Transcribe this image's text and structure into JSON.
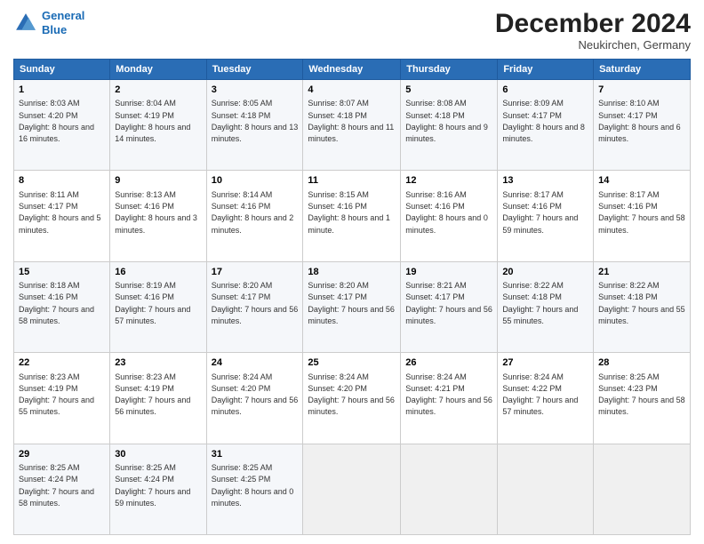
{
  "header": {
    "logo_line1": "General",
    "logo_line2": "Blue",
    "month": "December 2024",
    "location": "Neukirchen, Germany"
  },
  "weekdays": [
    "Sunday",
    "Monday",
    "Tuesday",
    "Wednesday",
    "Thursday",
    "Friday",
    "Saturday"
  ],
  "weeks": [
    [
      {
        "day": "1",
        "sunrise": "8:03 AM",
        "sunset": "4:20 PM",
        "daylight": "8 hours and 16 minutes."
      },
      {
        "day": "2",
        "sunrise": "8:04 AM",
        "sunset": "4:19 PM",
        "daylight": "8 hours and 14 minutes."
      },
      {
        "day": "3",
        "sunrise": "8:05 AM",
        "sunset": "4:18 PM",
        "daylight": "8 hours and 13 minutes."
      },
      {
        "day": "4",
        "sunrise": "8:07 AM",
        "sunset": "4:18 PM",
        "daylight": "8 hours and 11 minutes."
      },
      {
        "day": "5",
        "sunrise": "8:08 AM",
        "sunset": "4:18 PM",
        "daylight": "8 hours and 9 minutes."
      },
      {
        "day": "6",
        "sunrise": "8:09 AM",
        "sunset": "4:17 PM",
        "daylight": "8 hours and 8 minutes."
      },
      {
        "day": "7",
        "sunrise": "8:10 AM",
        "sunset": "4:17 PM",
        "daylight": "8 hours and 6 minutes."
      }
    ],
    [
      {
        "day": "8",
        "sunrise": "8:11 AM",
        "sunset": "4:17 PM",
        "daylight": "8 hours and 5 minutes."
      },
      {
        "day": "9",
        "sunrise": "8:13 AM",
        "sunset": "4:16 PM",
        "daylight": "8 hours and 3 minutes."
      },
      {
        "day": "10",
        "sunrise": "8:14 AM",
        "sunset": "4:16 PM",
        "daylight": "8 hours and 2 minutes."
      },
      {
        "day": "11",
        "sunrise": "8:15 AM",
        "sunset": "4:16 PM",
        "daylight": "8 hours and 1 minute."
      },
      {
        "day": "12",
        "sunrise": "8:16 AM",
        "sunset": "4:16 PM",
        "daylight": "8 hours and 0 minutes."
      },
      {
        "day": "13",
        "sunrise": "8:17 AM",
        "sunset": "4:16 PM",
        "daylight": "7 hours and 59 minutes."
      },
      {
        "day": "14",
        "sunrise": "8:17 AM",
        "sunset": "4:16 PM",
        "daylight": "7 hours and 58 minutes."
      }
    ],
    [
      {
        "day": "15",
        "sunrise": "8:18 AM",
        "sunset": "4:16 PM",
        "daylight": "7 hours and 58 minutes."
      },
      {
        "day": "16",
        "sunrise": "8:19 AM",
        "sunset": "4:16 PM",
        "daylight": "7 hours and 57 minutes."
      },
      {
        "day": "17",
        "sunrise": "8:20 AM",
        "sunset": "4:17 PM",
        "daylight": "7 hours and 56 minutes."
      },
      {
        "day": "18",
        "sunrise": "8:20 AM",
        "sunset": "4:17 PM",
        "daylight": "7 hours and 56 minutes."
      },
      {
        "day": "19",
        "sunrise": "8:21 AM",
        "sunset": "4:17 PM",
        "daylight": "7 hours and 56 minutes."
      },
      {
        "day": "20",
        "sunrise": "8:22 AM",
        "sunset": "4:18 PM",
        "daylight": "7 hours and 55 minutes."
      },
      {
        "day": "21",
        "sunrise": "8:22 AM",
        "sunset": "4:18 PM",
        "daylight": "7 hours and 55 minutes."
      }
    ],
    [
      {
        "day": "22",
        "sunrise": "8:23 AM",
        "sunset": "4:19 PM",
        "daylight": "7 hours and 55 minutes."
      },
      {
        "day": "23",
        "sunrise": "8:23 AM",
        "sunset": "4:19 PM",
        "daylight": "7 hours and 56 minutes."
      },
      {
        "day": "24",
        "sunrise": "8:24 AM",
        "sunset": "4:20 PM",
        "daylight": "7 hours and 56 minutes."
      },
      {
        "day": "25",
        "sunrise": "8:24 AM",
        "sunset": "4:20 PM",
        "daylight": "7 hours and 56 minutes."
      },
      {
        "day": "26",
        "sunrise": "8:24 AM",
        "sunset": "4:21 PM",
        "daylight": "7 hours and 56 minutes."
      },
      {
        "day": "27",
        "sunrise": "8:24 AM",
        "sunset": "4:22 PM",
        "daylight": "7 hours and 57 minutes."
      },
      {
        "day": "28",
        "sunrise": "8:25 AM",
        "sunset": "4:23 PM",
        "daylight": "7 hours and 58 minutes."
      }
    ],
    [
      {
        "day": "29",
        "sunrise": "8:25 AM",
        "sunset": "4:24 PM",
        "daylight": "7 hours and 58 minutes."
      },
      {
        "day": "30",
        "sunrise": "8:25 AM",
        "sunset": "4:24 PM",
        "daylight": "7 hours and 59 minutes."
      },
      {
        "day": "31",
        "sunrise": "8:25 AM",
        "sunset": "4:25 PM",
        "daylight": "8 hours and 0 minutes."
      },
      null,
      null,
      null,
      null
    ]
  ]
}
